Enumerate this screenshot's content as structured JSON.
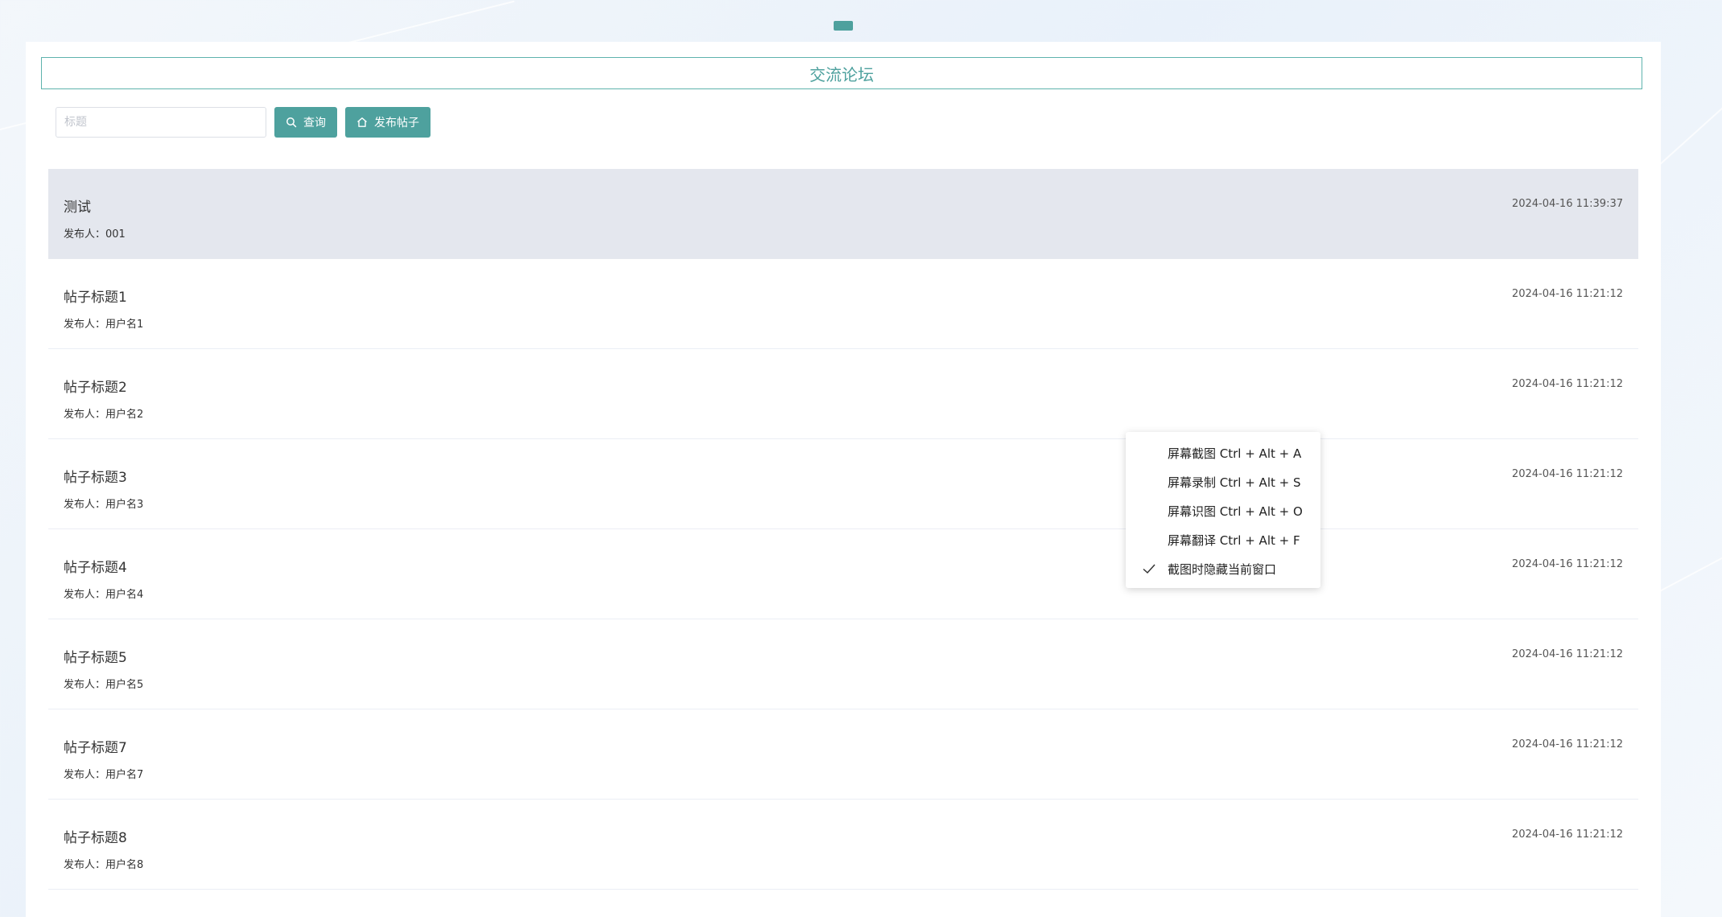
{
  "page": {
    "title": "交流论坛"
  },
  "search": {
    "placeholder": "标题",
    "value": ""
  },
  "toolbar": {
    "query_label": "查询",
    "publish_label": "发布帖子"
  },
  "posts": [
    {
      "title": "测试",
      "author": "发布人：001",
      "time": "2024-04-16 11:39:37",
      "highlighted": true
    },
    {
      "title": "帖子标题1",
      "author": "发布人：用户名1",
      "time": "2024-04-16 11:21:12"
    },
    {
      "title": "帖子标题2",
      "author": "发布人：用户名2",
      "time": "2024-04-16 11:21:12"
    },
    {
      "title": "帖子标题3",
      "author": "发布人：用户名3",
      "time": "2024-04-16 11:21:12"
    },
    {
      "title": "帖子标题4",
      "author": "发布人：用户名4",
      "time": "2024-04-16 11:21:12"
    },
    {
      "title": "帖子标题5",
      "author": "发布人：用户名5",
      "time": "2024-04-16 11:21:12"
    },
    {
      "title": "帖子标题7",
      "author": "发布人：用户名7",
      "time": "2024-04-16 11:21:12"
    },
    {
      "title": "帖子标题8",
      "author": "发布人：用户名8",
      "time": "2024-04-16 11:21:12"
    }
  ],
  "context_menu": {
    "items": [
      {
        "label": "屏幕截图 Ctrl + Alt + A",
        "checked": false
      },
      {
        "label": "屏幕录制 Ctrl + Alt + S",
        "checked": false
      },
      {
        "label": "屏幕识图 Ctrl + Alt + O",
        "checked": false
      },
      {
        "label": "屏幕翻译 Ctrl + Alt + F",
        "checked": false
      },
      {
        "label": "截图时隐藏当前窗口",
        "checked": true
      }
    ]
  },
  "colors": {
    "accent": "#4ea19e",
    "highlight_row": "#e4e7ee"
  },
  "icons": {
    "query_button": "search-icon",
    "publish_button": "home-icon",
    "menu_check": "check-icon"
  }
}
